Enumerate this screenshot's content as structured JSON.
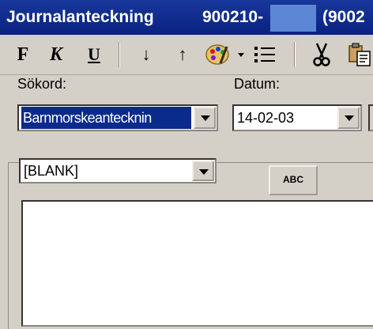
{
  "window": {
    "title": "Journalanteckning",
    "patient_id": "900210-",
    "patient_extra": "(9002"
  },
  "toolbar": {
    "bold": "F",
    "italic": "K",
    "underline": "U",
    "down_arrow": "↓",
    "up_arrow": "↑",
    "palette_icon": "palette-icon",
    "list_icon": "list-icon",
    "cut_icon": "scissors-icon",
    "paste_icon": "paste-icon"
  },
  "form": {
    "sokord_label": "Sökord:",
    "sokord_value": "Barnmorskeantecknin",
    "datum_label": "Datum:",
    "datum_value": "14-02-03",
    "template_value": "[BLANK]",
    "abc_label": "ABC"
  }
}
